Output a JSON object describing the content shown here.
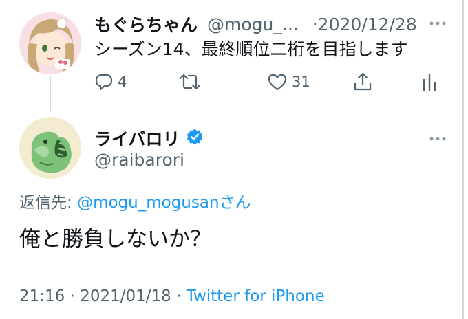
{
  "parent_tweet": {
    "display_name": "もぐらちゃん",
    "handle": "@mogu_...",
    "date": "·2020/12/28",
    "text": "シーズン14、最終順位二桁を目指します",
    "reply_count": "4",
    "retweet_count": "",
    "like_count": "31"
  },
  "reply_tweet": {
    "display_name": "ライバロリ",
    "handle": "@raibarori",
    "verified": true,
    "reply_to_prefix": "返信先: ",
    "reply_to_handle": "@mogu_mogusanさん",
    "text": "俺と勝負しないか？",
    "time": "21:16 · 2021/01/18 · ",
    "source": "Twitter for iPhone"
  },
  "colors": {
    "text": "#0f1419",
    "secondary": "#536471",
    "accent": "#1d9bf0",
    "thread_line": "#cfd9de"
  },
  "icons": {
    "reply": "reply-icon",
    "retweet": "retweet-icon",
    "like": "heart-icon",
    "share": "share-icon",
    "analytics": "analytics-icon",
    "more": "more-icon",
    "verified": "verified-badge-icon"
  }
}
